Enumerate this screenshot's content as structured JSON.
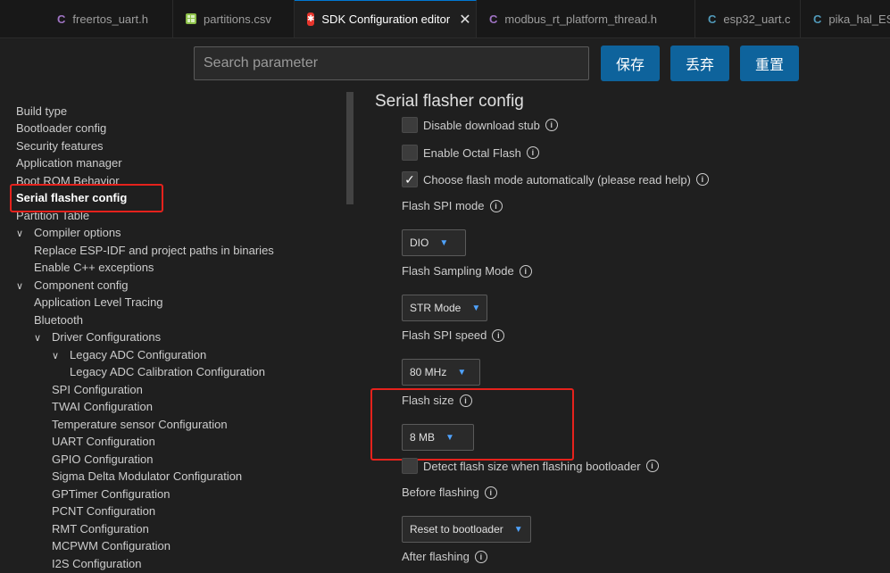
{
  "tabs": [
    {
      "label": "freertos_uart.h",
      "icon": "c-file-icon",
      "active": false
    },
    {
      "label": "partitions.csv",
      "icon": "csv-file-icon",
      "active": false
    },
    {
      "label": "SDK Configuration editor",
      "icon": "esp-idf-icon",
      "active": true
    },
    {
      "label": "modbus_rt_platform_thread.h",
      "icon": "c-file-icon",
      "active": false
    },
    {
      "label": "esp32_uart.c",
      "icon": "c-file-icon",
      "active": false
    },
    {
      "label": "pika_hal_ESP",
      "icon": "c-file-icon",
      "active": false
    }
  ],
  "tab_close_glyph": "✕",
  "search": {
    "placeholder": "Search parameter",
    "value": ""
  },
  "buttons": {
    "save": "保存",
    "discard": "丢弃",
    "reset": "重置"
  },
  "sidebar": {
    "items": [
      {
        "label": "Build type"
      },
      {
        "label": "Bootloader config"
      },
      {
        "label": "Security features"
      },
      {
        "label": "Application manager"
      },
      {
        "label": "Boot ROM Behavior"
      },
      {
        "label": "Serial flasher config",
        "selected": true
      },
      {
        "label": "Partition Table"
      },
      {
        "label": "Compiler options",
        "expanded": true
      },
      {
        "label": "Replace ESP-IDF and project paths in binaries"
      },
      {
        "label": "Enable C++ exceptions"
      },
      {
        "label": "Component config",
        "expanded": true
      },
      {
        "label": "Application Level Tracing"
      },
      {
        "label": "Bluetooth"
      },
      {
        "label": "Driver Configurations",
        "expanded": true
      },
      {
        "label": "Legacy ADC Configuration",
        "expanded": true
      },
      {
        "label": "Legacy ADC Calibration Configuration"
      },
      {
        "label": "SPI Configuration"
      },
      {
        "label": "TWAI Configuration"
      },
      {
        "label": "Temperature sensor Configuration"
      },
      {
        "label": "UART Configuration"
      },
      {
        "label": "GPIO Configuration"
      },
      {
        "label": "Sigma Delta Modulator Configuration"
      },
      {
        "label": "GPTimer Configuration"
      },
      {
        "label": "PCNT Configuration"
      },
      {
        "label": "RMT Configuration"
      },
      {
        "label": "MCPWM Configuration"
      },
      {
        "label": "I2S Configuration"
      }
    ]
  },
  "main": {
    "section_title": "Serial flasher config",
    "disable_download_stub": {
      "label": "Disable download stub",
      "checked": false
    },
    "enable_octal_flash": {
      "label": "Enable Octal Flash",
      "checked": false
    },
    "choose_flash_mode_auto": {
      "label": "Choose flash mode automatically (please read help)",
      "checked": true,
      "check_glyph": "✓"
    },
    "flash_spi_mode": {
      "label": "Flash SPI mode",
      "value": "DIO"
    },
    "flash_sampling_mode": {
      "label": "Flash Sampling Mode",
      "value": "STR Mode"
    },
    "flash_spi_speed": {
      "label": "Flash SPI speed",
      "value": "80 MHz"
    },
    "flash_size": {
      "label": "Flash size",
      "value": "8 MB"
    },
    "detect_flash_size": {
      "label": "Detect flash size when flashing bootloader",
      "checked": false
    },
    "before_flashing": {
      "label": "Before flashing",
      "value": "Reset to bootloader"
    },
    "after_flashing": {
      "label": "After flashing"
    },
    "info_glyph": "i",
    "dropdown_glyph": "▼"
  },
  "colors": {
    "accent_button": "#0e639c",
    "highlight_box": "#e5221c",
    "dropdown_chevron": "#4fa3ff"
  }
}
